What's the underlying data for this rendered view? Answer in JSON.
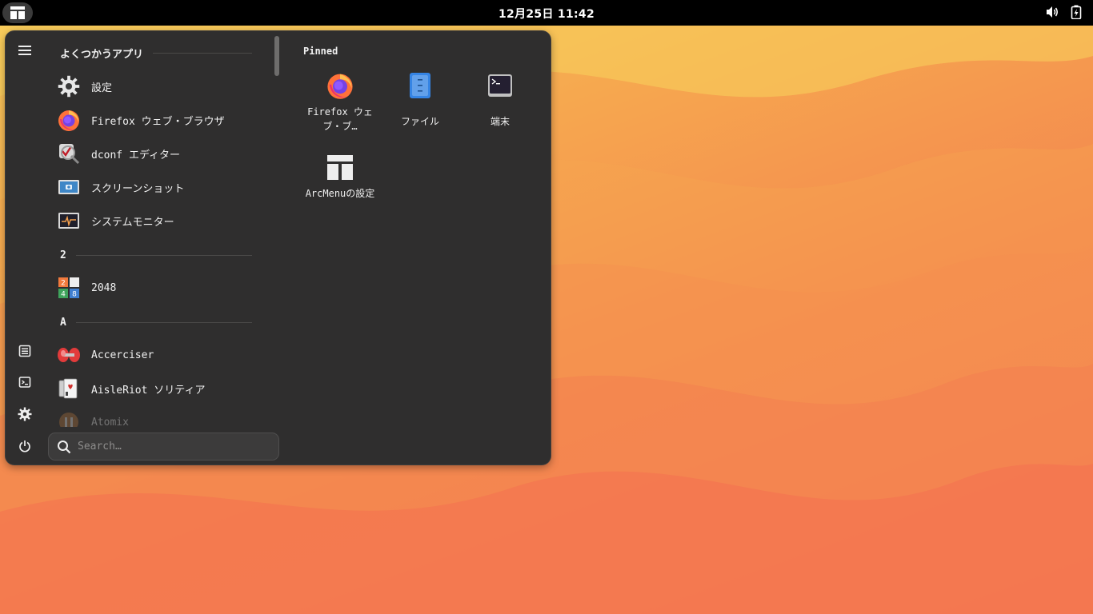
{
  "topbar": {
    "clock": "12月25日  11:42",
    "icons": [
      "app-menu-icon",
      "volume-icon",
      "battery-icon"
    ]
  },
  "menu": {
    "sections": {
      "frequent": "よくつかうアプリ",
      "two": "2",
      "a": "A"
    },
    "apps": [
      {
        "label": "設定",
        "icon": "settings-gear-icon"
      },
      {
        "label": "Firefox ウェブ・ブラウザ",
        "icon": "firefox-icon"
      },
      {
        "label": "dconf エディター",
        "icon": "dconf-editor-icon"
      },
      {
        "label": "スクリーンショット",
        "icon": "screenshot-icon"
      },
      {
        "label": "システムモニター",
        "icon": "system-monitor-icon"
      },
      {
        "label": "2048",
        "icon": "game-2048-icon"
      },
      {
        "label": "Accerciser",
        "icon": "accerciser-icon"
      },
      {
        "label": "AisleRiot ソリティア",
        "icon": "solitaire-icon"
      },
      {
        "label": "Atomix",
        "icon": "atomix-icon"
      }
    ],
    "sidebar_icons": [
      "hamburger-menu-icon",
      "documents-icon",
      "terminal-icon",
      "settings-icon",
      "power-icon"
    ],
    "search_placeholder": "Search…",
    "pinned": {
      "title": "Pinned",
      "tiles": [
        {
          "label": "Firefox ウェブ・ブ…",
          "icon": "firefox-icon"
        },
        {
          "label": "ファイル",
          "icon": "files-icon"
        },
        {
          "label": "端末",
          "icon": "terminal-icon"
        },
        {
          "label": "ArcMenuの設定",
          "icon": "arcmenu-settings-icon"
        }
      ]
    }
  },
  "colors": {
    "menu_bg": "#2f2e2e",
    "topbar_bg": "#000000",
    "wallpaper_top": "#f7c95a",
    "wallpaper_bottom": "#f36a52"
  }
}
